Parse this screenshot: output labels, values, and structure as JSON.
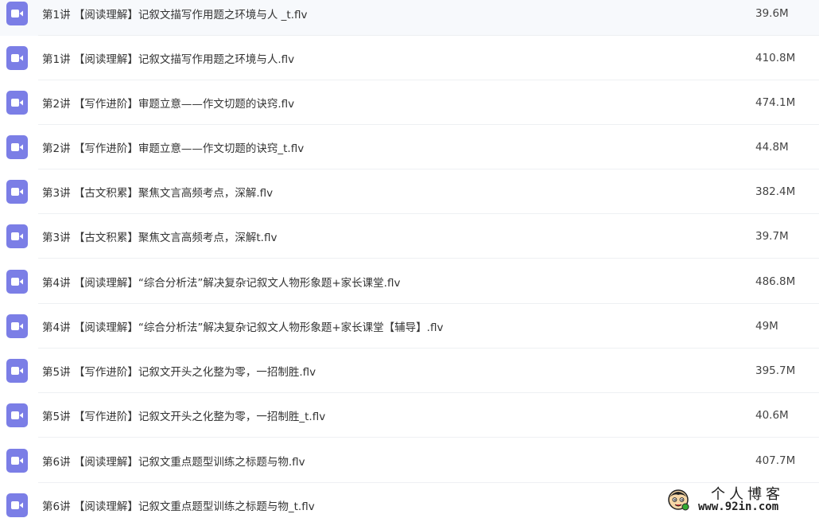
{
  "files": [
    {
      "name": "第1讲 【阅读理解】记叙文描写作用题之环境与人 _t.flv",
      "size": "39.6M",
      "icon": "video-file-icon"
    },
    {
      "name": "第1讲 【阅读理解】记叙文描写作用题之环境与人.flv",
      "size": "410.8M",
      "icon": "video-file-icon"
    },
    {
      "name": "第2讲 【写作进阶】审题立意——作文切题的诀窍.flv",
      "size": "474.1M",
      "icon": "video-file-icon"
    },
    {
      "name": "第2讲 【写作进阶】审题立意——作文切题的诀窍_t.flv",
      "size": "44.8M",
      "icon": "video-file-icon"
    },
    {
      "name": "第3讲 【古文积累】聚焦文言高频考点，深解.flv",
      "size": "382.4M",
      "icon": "video-file-icon"
    },
    {
      "name": "第3讲 【古文积累】聚焦文言高频考点，深解t.flv",
      "size": "39.7M",
      "icon": "video-file-icon"
    },
    {
      "name": "第4讲 【阅读理解】“综合分析法”解决复杂记叙文人物形象题+家长课堂.flv",
      "size": "486.8M",
      "icon": "video-file-icon"
    },
    {
      "name": "第4讲 【阅读理解】“综合分析法”解决复杂记叙文人物形象题+家长课堂【辅导】.flv",
      "size": "49M",
      "icon": "video-file-icon"
    },
    {
      "name": "第5讲 【写作进阶】记叙文开头之化整为零，一招制胜.flv",
      "size": "395.7M",
      "icon": "video-file-icon"
    },
    {
      "name": "第5讲 【写作进阶】记叙文开头之化整为零，一招制胜_t.flv",
      "size": "40.6M",
      "icon": "video-file-icon"
    },
    {
      "name": "第6讲 【阅读理解】记叙文重点题型训练之标题与物.flv",
      "size": "407.7M",
      "icon": "video-file-icon"
    },
    {
      "name": "第6讲 【阅读理解】记叙文重点题型训练之标题与物_t.flv",
      "size": "",
      "icon": "video-file-icon"
    }
  ],
  "watermark": {
    "title": "个人博客",
    "url": "www.92in.com"
  },
  "colors": {
    "icon_bg": "#7b7ee6",
    "text": "#333333",
    "divider": "#eef0f3"
  }
}
